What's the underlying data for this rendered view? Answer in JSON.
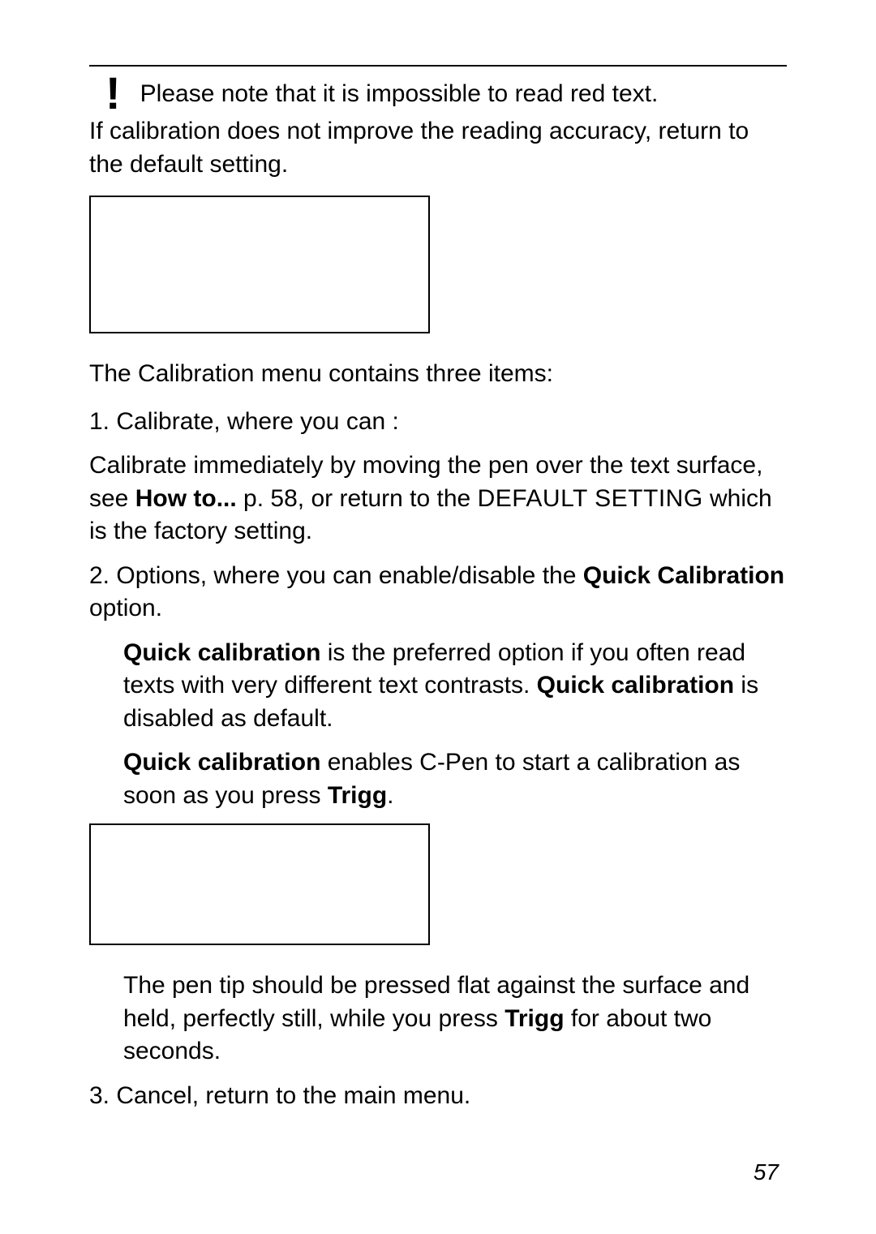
{
  "note": {
    "icon_glyph": "!",
    "text": "Please note that it is impossible to read red text."
  },
  "intro_para": "If calibration does not improve the reading accuracy, return to the default setting.",
  "menu_intro": "The Calibration menu contains three items:",
  "item1": {
    "head": "1. Calibrate, where you can :",
    "body_a": "Calibrate immediately by moving the pen over the text surface, see ",
    "body_b_bold": "How to... ",
    "body_c": "p. 58, or return to the ",
    "body_d_sc": "DEFAULT SETTING",
    "body_e": " which is the factory setting."
  },
  "item2": {
    "head_a": "2. Options, where you can enable/disable the ",
    "head_b_bold": "Quick Calibration",
    "head_c": " option.",
    "para1_a": "Quick calibration",
    "para1_b": " is the preferred option if you often read texts with very different text contrasts. ",
    "para1_c": "Quick calibration",
    "para1_d": " is disabled as default.",
    "para2_a": "Quick calibration",
    "para2_b": " enables C-Pen to start a calibration as soon as you press ",
    "para2_c_bold": "Trigg",
    "para2_d": ".",
    "para3_a": "The pen tip should be pressed flat against the surface and held, perfectly still, while you press ",
    "para3_b_bold": "Trigg",
    "para3_c": " for about two seconds."
  },
  "item3": {
    "text_a": "3. Cancel",
    "text_b": ", return to the main menu."
  },
  "page_number": "57"
}
